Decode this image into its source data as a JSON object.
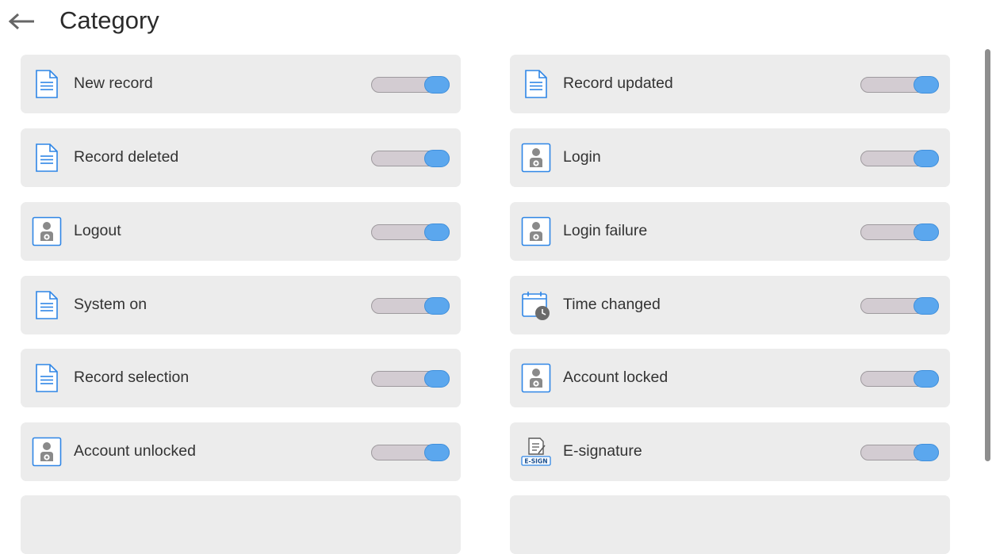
{
  "header": {
    "title": "Category",
    "back_icon": "arrow-left-icon"
  },
  "colors": {
    "card_bg": "#ececec",
    "toggle_track": "#d3ccd2",
    "toggle_knob_on": "#5ba7ee",
    "icon_blue": "#2f86e6",
    "icon_gray": "#8a8a8a"
  },
  "categories": {
    "left": [
      {
        "label": "New record",
        "icon": "document-icon",
        "enabled": true
      },
      {
        "label": "Record deleted",
        "icon": "document-icon",
        "enabled": true
      },
      {
        "label": "Logout",
        "icon": "user-settings-icon",
        "enabled": true
      },
      {
        "label": "System on",
        "icon": "document-icon",
        "enabled": true
      },
      {
        "label": "Record selection",
        "icon": "document-icon",
        "enabled": true
      },
      {
        "label": "Account unlocked",
        "icon": "user-settings-icon",
        "enabled": true
      }
    ],
    "right": [
      {
        "label": "Record updated",
        "icon": "document-icon",
        "enabled": true
      },
      {
        "label": "Login",
        "icon": "user-settings-icon",
        "enabled": true
      },
      {
        "label": "Login failure",
        "icon": "user-settings-icon",
        "enabled": true
      },
      {
        "label": "Time changed",
        "icon": "calendar-clock-icon",
        "enabled": true
      },
      {
        "label": "Account locked",
        "icon": "user-settings-icon",
        "enabled": true
      },
      {
        "label": "E-signature",
        "icon": "e-sign-icon",
        "enabled": true,
        "icon_text": "E-SIGN"
      }
    ]
  }
}
